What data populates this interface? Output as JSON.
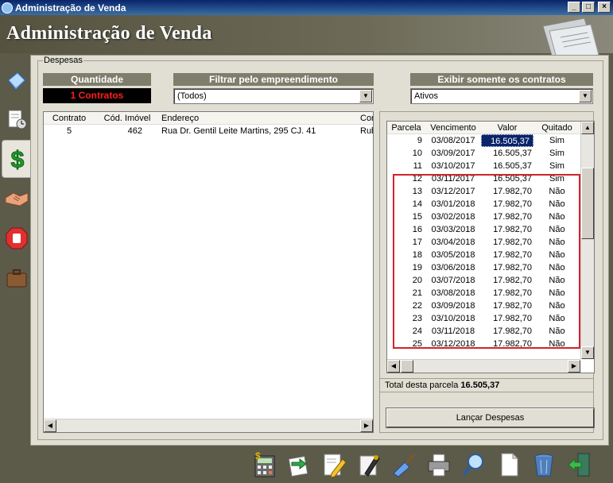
{
  "window": {
    "title": "Administração de Venda"
  },
  "header": {
    "title": "Administração de Venda"
  },
  "sidebar": {
    "items": [
      "documents-icon",
      "calendar-clock-icon",
      "dollar-icon",
      "handshake-icon",
      "stop-icon",
      "briefcase-icon"
    ]
  },
  "group": {
    "title": "Despesas"
  },
  "quantidade": {
    "label": "Quantidade",
    "value": "1 Contratos"
  },
  "filtro": {
    "label": "Filtrar pelo empreendimento",
    "value": "(Todos)"
  },
  "exibir": {
    "label": "Exibir somente os contratos",
    "value": "Ativos"
  },
  "contracts": {
    "headers": [
      "Contrato",
      "Cód. Imóvel",
      "Endereço",
      "Cor"
    ],
    "rows": [
      [
        "5",
        "462",
        "Rua Dr. Gentil Leite Martins, 295 CJ. 41",
        "Rub"
      ]
    ]
  },
  "installments": {
    "headers": [
      "Parcela",
      "Vencimento",
      "Valor",
      "Quitado"
    ],
    "rows": [
      [
        "9",
        "03/08/2017",
        "16.505,37",
        "Sim"
      ],
      [
        "10",
        "03/09/2017",
        "16.505,37",
        "Sim"
      ],
      [
        "11",
        "03/10/2017",
        "16.505,37",
        "Sim"
      ],
      [
        "12",
        "03/11/2017",
        "16.505,37",
        "Sim"
      ],
      [
        "13",
        "03/12/2017",
        "17.982,70",
        "Não"
      ],
      [
        "14",
        "03/01/2018",
        "17.982,70",
        "Não"
      ],
      [
        "15",
        "03/02/2018",
        "17.982,70",
        "Não"
      ],
      [
        "16",
        "03/03/2018",
        "17.982,70",
        "Não"
      ],
      [
        "17",
        "03/04/2018",
        "17.982,70",
        "Não"
      ],
      [
        "18",
        "03/05/2018",
        "17.982,70",
        "Não"
      ],
      [
        "19",
        "03/06/2018",
        "17.982,70",
        "Não"
      ],
      [
        "20",
        "03/07/2018",
        "17.982,70",
        "Não"
      ],
      [
        "21",
        "03/08/2018",
        "17.982,70",
        "Não"
      ],
      [
        "22",
        "03/09/2018",
        "17.982,70",
        "Não"
      ],
      [
        "23",
        "03/10/2018",
        "17.982,70",
        "Não"
      ],
      [
        "24",
        "03/11/2018",
        "17.982,70",
        "Não"
      ],
      [
        "25",
        "03/12/2018",
        "17.982,70",
        "Não"
      ]
    ]
  },
  "total": {
    "label": "Total desta parcela",
    "value": "16.505,37"
  },
  "lancar": {
    "label": "Lançar Despesas"
  },
  "toolbar": {
    "items": [
      "calculator-icon",
      "exchange-icon",
      "edit-icon",
      "sign-icon",
      "clean-icon",
      "print-icon",
      "search-icon",
      "new-document-icon",
      "trash-icon",
      "exit-icon"
    ]
  },
  "colors": {
    "accent": "#0a246a",
    "highlight_border": "#d2232a",
    "quantity_text": "#ff1d1d",
    "section_header": "#7f7d6b"
  }
}
